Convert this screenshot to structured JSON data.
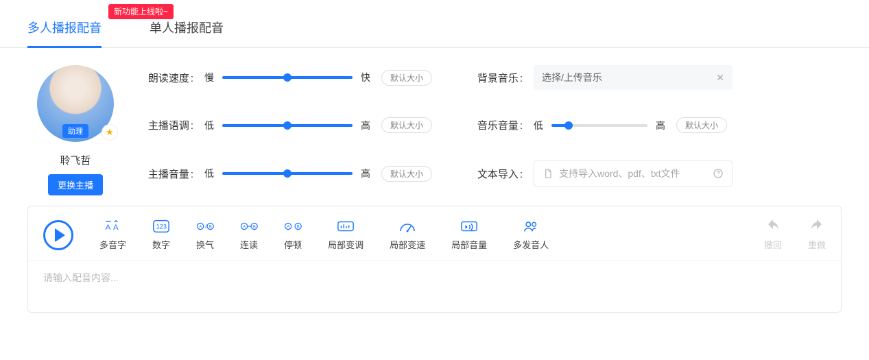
{
  "badge": {
    "text": "新功能上线啦~"
  },
  "tabs": {
    "multi": "多人播报配音",
    "single": "单人播报配音"
  },
  "profile": {
    "role": "助理",
    "name": "聆飞哲",
    "swap": "更换主播"
  },
  "speed": {
    "label": "朗读速度",
    "lo": "慢",
    "hi": "快",
    "default": "默认大小",
    "pct": 50
  },
  "tone": {
    "label": "主播语调",
    "lo": "低",
    "hi": "高",
    "default": "默认大小",
    "pct": 50
  },
  "volume": {
    "label": "主播音量",
    "lo": "低",
    "hi": "高",
    "default": "默认大小",
    "pct": 50
  },
  "bgm": {
    "label": "背景音乐",
    "placeholder": "选择/上传音乐"
  },
  "bgvol": {
    "label": "音乐音量",
    "lo": "低",
    "hi": "高",
    "default": "默认大小",
    "pct": 18
  },
  "import": {
    "label": "文本导入",
    "hint": "支持导入word、pdf、txt文件"
  },
  "tools": {
    "polyphone": "多音字",
    "number": "数字",
    "breath": "换气",
    "liaison": "连读",
    "pause": "停顿",
    "localpitch": "局部变调",
    "localspeed": "局部变速",
    "localvol": "局部音量",
    "multivoice": "多发音人",
    "undo": "撤回",
    "redo": "重做"
  },
  "editor": {
    "placeholder": "请输入配音内容..."
  }
}
